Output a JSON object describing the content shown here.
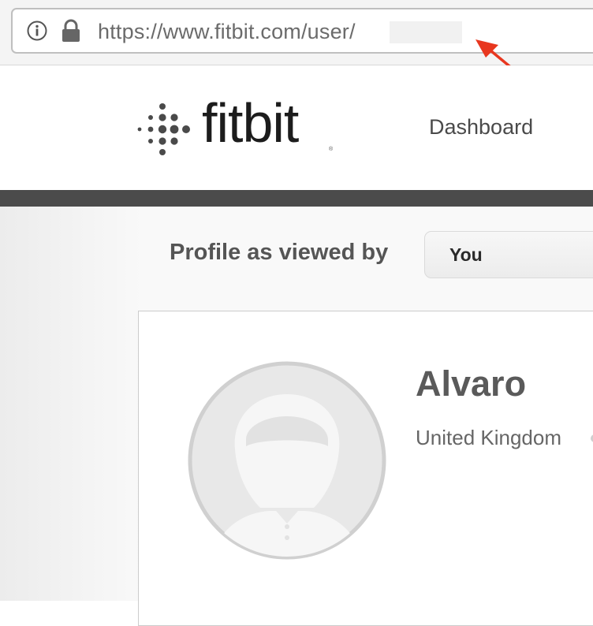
{
  "browser": {
    "url": "https://www.fitbit.com/user/",
    "icons": [
      "info-icon",
      "lock-icon"
    ]
  },
  "header": {
    "logo_text": "fitbit",
    "logo_registered": "®",
    "nav": {
      "dashboard_label": "Dashboard"
    }
  },
  "profile_view": {
    "label": "Profile as viewed by",
    "selected_value": "You"
  },
  "profile": {
    "name": "Alvaro",
    "location": "United Kingdom",
    "avatar_icon": "default-avatar-icon"
  },
  "colors": {
    "annotation_arrow": "#e8371f",
    "header_bar": "#4b4b4b",
    "logo": "#1c1c1c"
  }
}
